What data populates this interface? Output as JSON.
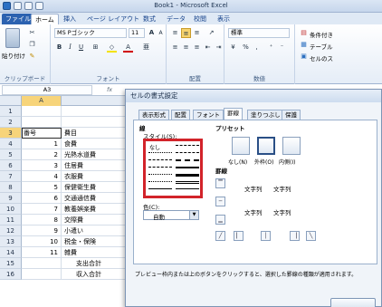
{
  "window": {
    "title": "Book1 - Microsoft Excel"
  },
  "ribbon": {
    "tabs": [
      {
        "label": "ファイル"
      },
      {
        "label": "ホーム"
      },
      {
        "label": "挿入"
      },
      {
        "label": "ページ レイアウト"
      },
      {
        "label": "数式"
      },
      {
        "label": "データ"
      },
      {
        "label": "校閲"
      },
      {
        "label": "表示"
      }
    ],
    "clipboard": {
      "paste_label": "貼り付け",
      "group_label": "クリップボード"
    },
    "font": {
      "name": "MS Pゴシック",
      "size": "11",
      "bold": "B",
      "italic": "I",
      "underline": "U",
      "grow": "A",
      "shrink": "A",
      "color_a": "A",
      "phonetic": "亜",
      "group_label": "フォント"
    },
    "alignment": {
      "group_label": "配置"
    },
    "number": {
      "format": "標準",
      "group_label": "数値"
    },
    "styles": {
      "cond_format": "条件付き",
      "table_format": "テーブル",
      "cell_styles": "セルのス"
    }
  },
  "formula_bar": {
    "name_box": "A3",
    "fx": "fx"
  },
  "sheet": {
    "columns": [
      "A",
      "B"
    ],
    "rows": [
      {
        "num": "1",
        "a": "",
        "b": ""
      },
      {
        "num": "2",
        "a": "",
        "b": ""
      },
      {
        "num": "3",
        "a": "番号",
        "b": "費目"
      },
      {
        "num": "4",
        "a": "1",
        "b": "食費"
      },
      {
        "num": "5",
        "a": "2",
        "b": "光熱水道費"
      },
      {
        "num": "6",
        "a": "3",
        "b": "住居費"
      },
      {
        "num": "7",
        "a": "4",
        "b": "衣服費"
      },
      {
        "num": "8",
        "a": "5",
        "b": "保健衛生費"
      },
      {
        "num": "9",
        "a": "6",
        "b": "交通通信費"
      },
      {
        "num": "10",
        "a": "7",
        "b": "教養娯楽費"
      },
      {
        "num": "11",
        "a": "8",
        "b": "交際費"
      },
      {
        "num": "12",
        "a": "9",
        "b": "小遣い"
      },
      {
        "num": "13",
        "a": "10",
        "b": "税金・保険"
      },
      {
        "num": "14",
        "a": "11",
        "b": "雑費"
      },
      {
        "num": "15",
        "a": "",
        "b": "支出合計"
      },
      {
        "num": "16",
        "a": "",
        "b": "収入合計"
      }
    ]
  },
  "dialog": {
    "title": "セルの書式設定",
    "tabs": [
      {
        "label": "表示形式"
      },
      {
        "label": "配置"
      },
      {
        "label": "フォント"
      },
      {
        "label": "罫線"
      },
      {
        "label": "塗りつぶし"
      },
      {
        "label": "保護"
      }
    ],
    "line_label": "線",
    "style_label": "スタイル(S):",
    "none_label": "なし",
    "preset_label": "プリセット",
    "presets": [
      {
        "label": "なし(N)"
      },
      {
        "label": "外枠(O)"
      },
      {
        "label": "内側(I)"
      }
    ],
    "border_label": "罫線",
    "sample_text": "文字列",
    "color_label": "色(C):",
    "color_value": "自動",
    "hint": "プレビュー枠内または上のボタンをクリックすると、選択した罫線の種類が適用されます。",
    "highlight_color": "#d2232a"
  }
}
